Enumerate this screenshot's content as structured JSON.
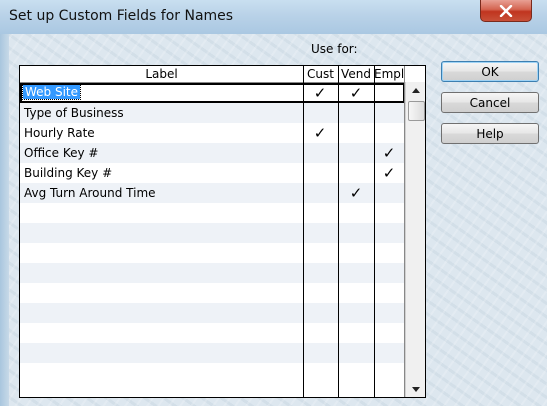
{
  "window": {
    "title": "Set up Custom Fields for Names",
    "close_symbol": "x"
  },
  "use_for_label": "Use for:",
  "columns": {
    "label": "Label",
    "cust": "Cust",
    "vend": "Vend",
    "empl": "Empl"
  },
  "check_glyph": "✓",
  "rows": [
    {
      "label": "Web Site",
      "cust": true,
      "vend": true,
      "empl": false
    },
    {
      "label": "Type of Business",
      "cust": false,
      "vend": false,
      "empl": false
    },
    {
      "label": "Hourly Rate",
      "cust": true,
      "vend": false,
      "empl": false
    },
    {
      "label": "Office Key #",
      "cust": false,
      "vend": false,
      "empl": true
    },
    {
      "label": "Building Key #",
      "cust": false,
      "vend": false,
      "empl": true
    },
    {
      "label": "Avg Turn Around Time",
      "cust": false,
      "vend": true,
      "empl": false
    },
    {
      "label": "",
      "cust": false,
      "vend": false,
      "empl": false
    },
    {
      "label": "",
      "cust": false,
      "vend": false,
      "empl": false
    },
    {
      "label": "",
      "cust": false,
      "vend": false,
      "empl": false
    },
    {
      "label": "",
      "cust": false,
      "vend": false,
      "empl": false
    },
    {
      "label": "",
      "cust": false,
      "vend": false,
      "empl": false
    },
    {
      "label": "",
      "cust": false,
      "vend": false,
      "empl": false
    },
    {
      "label": "",
      "cust": false,
      "vend": false,
      "empl": false
    },
    {
      "label": "",
      "cust": false,
      "vend": false,
      "empl": false
    },
    {
      "label": "",
      "cust": false,
      "vend": false,
      "empl": false
    }
  ],
  "selected_row": 0,
  "buttons": {
    "ok": "OK",
    "cancel": "Cancel",
    "help": "Help"
  },
  "colors": {
    "selection": "#3399ff",
    "alt_row": "#eef2f7"
  }
}
